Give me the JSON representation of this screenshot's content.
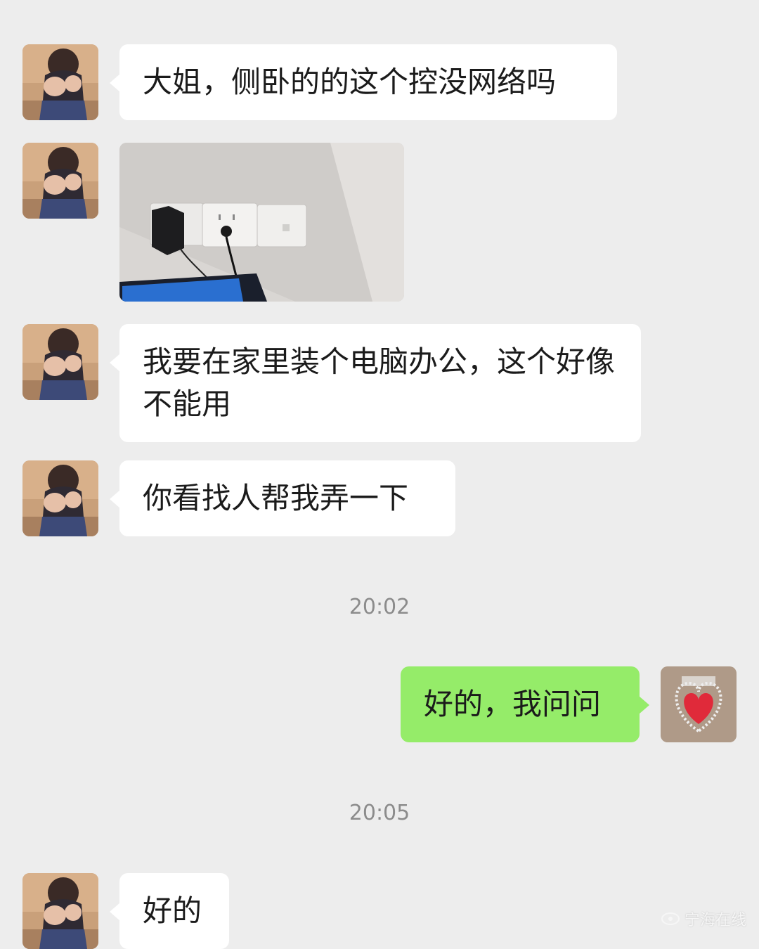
{
  "chat": {
    "messages": [
      {
        "side": "in",
        "type": "text",
        "text": "大姐，侧卧的的这个控没网络吗"
      },
      {
        "side": "in",
        "type": "image",
        "alt": ""
      },
      {
        "side": "in",
        "type": "text",
        "text": "我要在家里装个电脑办公，这个好像不能用"
      },
      {
        "side": "in",
        "type": "text",
        "text": "你看找人帮我弄一下"
      },
      {
        "side": "out",
        "type": "text",
        "text": "好的，我问问"
      },
      {
        "side": "in",
        "type": "text",
        "text": "好的"
      }
    ],
    "timestamps": [
      "20:02",
      "20:05"
    ]
  },
  "watermark": {
    "text": "宁海在线"
  },
  "colors": {
    "background": "#ededed",
    "incoming_bubble": "#ffffff",
    "outgoing_bubble": "#95ec69",
    "timestamp_text": "#8c8c8c"
  }
}
